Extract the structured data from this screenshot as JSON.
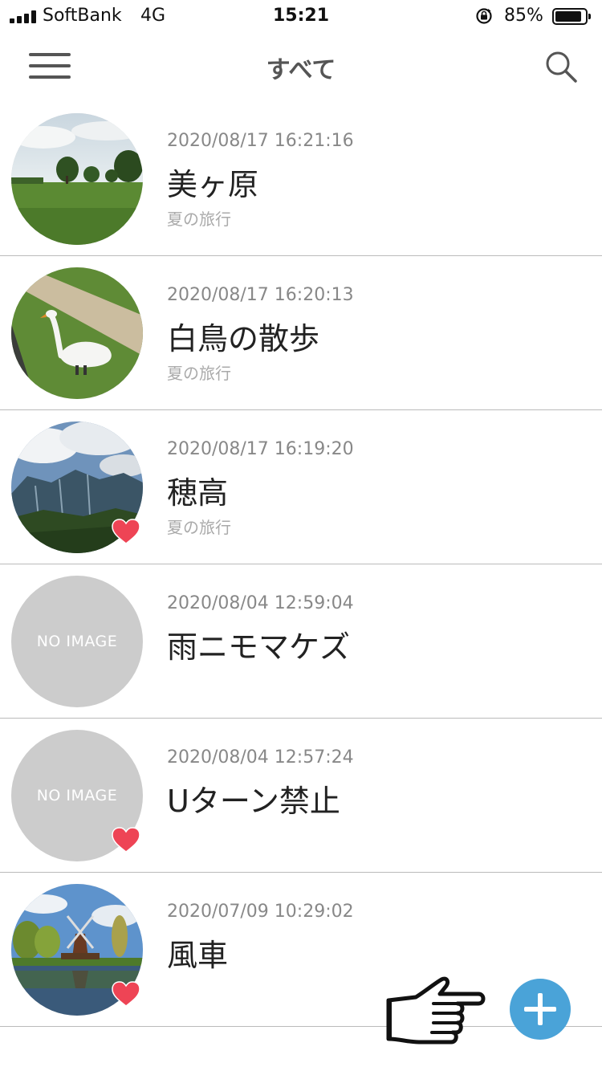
{
  "status_bar": {
    "carrier": "SoftBank",
    "network": "4G",
    "time": "15:21",
    "battery_percent": "85%"
  },
  "nav": {
    "title": "すべて",
    "menu_icon": "hamburger-menu-icon",
    "search_icon": "search-icon"
  },
  "entries": [
    {
      "date": "2020/08/17 16:21:16",
      "title": "美ヶ原",
      "album": "夏の旅行",
      "image": "field-photo",
      "favorite": false
    },
    {
      "date": "2020/08/17 16:20:13",
      "title": "白鳥の散歩",
      "album": "夏の旅行",
      "image": "swan-photo",
      "favorite": false
    },
    {
      "date": "2020/08/17 16:19:20",
      "title": "穂高",
      "album": "夏の旅行",
      "image": "mountain-photo",
      "favorite": true
    },
    {
      "date": "2020/08/04 12:59:04",
      "title": "雨ニモマケズ",
      "album": "",
      "image": "NO IMAGE",
      "favorite": false
    },
    {
      "date": "2020/08/04 12:57:24",
      "title": "Uターン禁止",
      "album": "",
      "image": "NO IMAGE",
      "favorite": true
    },
    {
      "date": "2020/07/09 10:29:02",
      "title": "風車",
      "album": "",
      "image": "windmill-photo",
      "favorite": true
    }
  ],
  "colors": {
    "fab": "#4aa3d8",
    "heart": "#ee4455"
  },
  "fab_icon": "plus-icon",
  "pointer_icon": "pointing-hand-icon"
}
